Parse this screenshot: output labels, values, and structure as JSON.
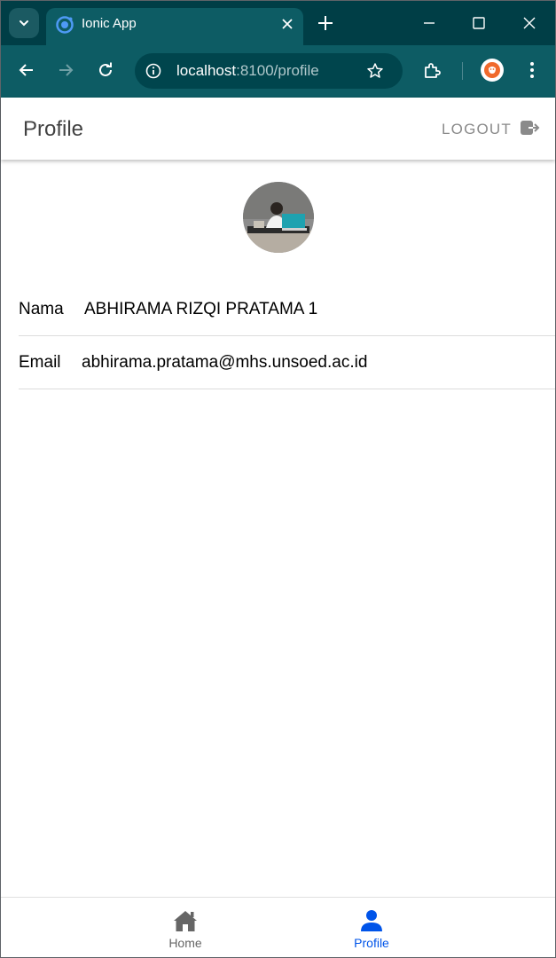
{
  "browser": {
    "tab_title": "Ionic App",
    "url_host": "localhost",
    "url_rest": ":8100/profile"
  },
  "header": {
    "title": "Profile",
    "logout_label": "LOGOUT"
  },
  "profile": {
    "fields": [
      {
        "label": "Nama",
        "value": "ABHIRAMA RIZQI PRATAMA 1"
      },
      {
        "label": "Email",
        "value": "abhirama.pratama@mhs.unsoed.ac.id"
      }
    ]
  },
  "tabbar": {
    "items": [
      {
        "label": "Home",
        "icon": "home-icon",
        "selected": false
      },
      {
        "label": "Profile",
        "icon": "person-icon",
        "selected": true
      }
    ]
  },
  "colors": {
    "chrome_dark": "#003e46",
    "chrome_toolbar": "#0d5c64",
    "ionic_primary": "#0054e9",
    "tab_inactive": "#666666"
  }
}
